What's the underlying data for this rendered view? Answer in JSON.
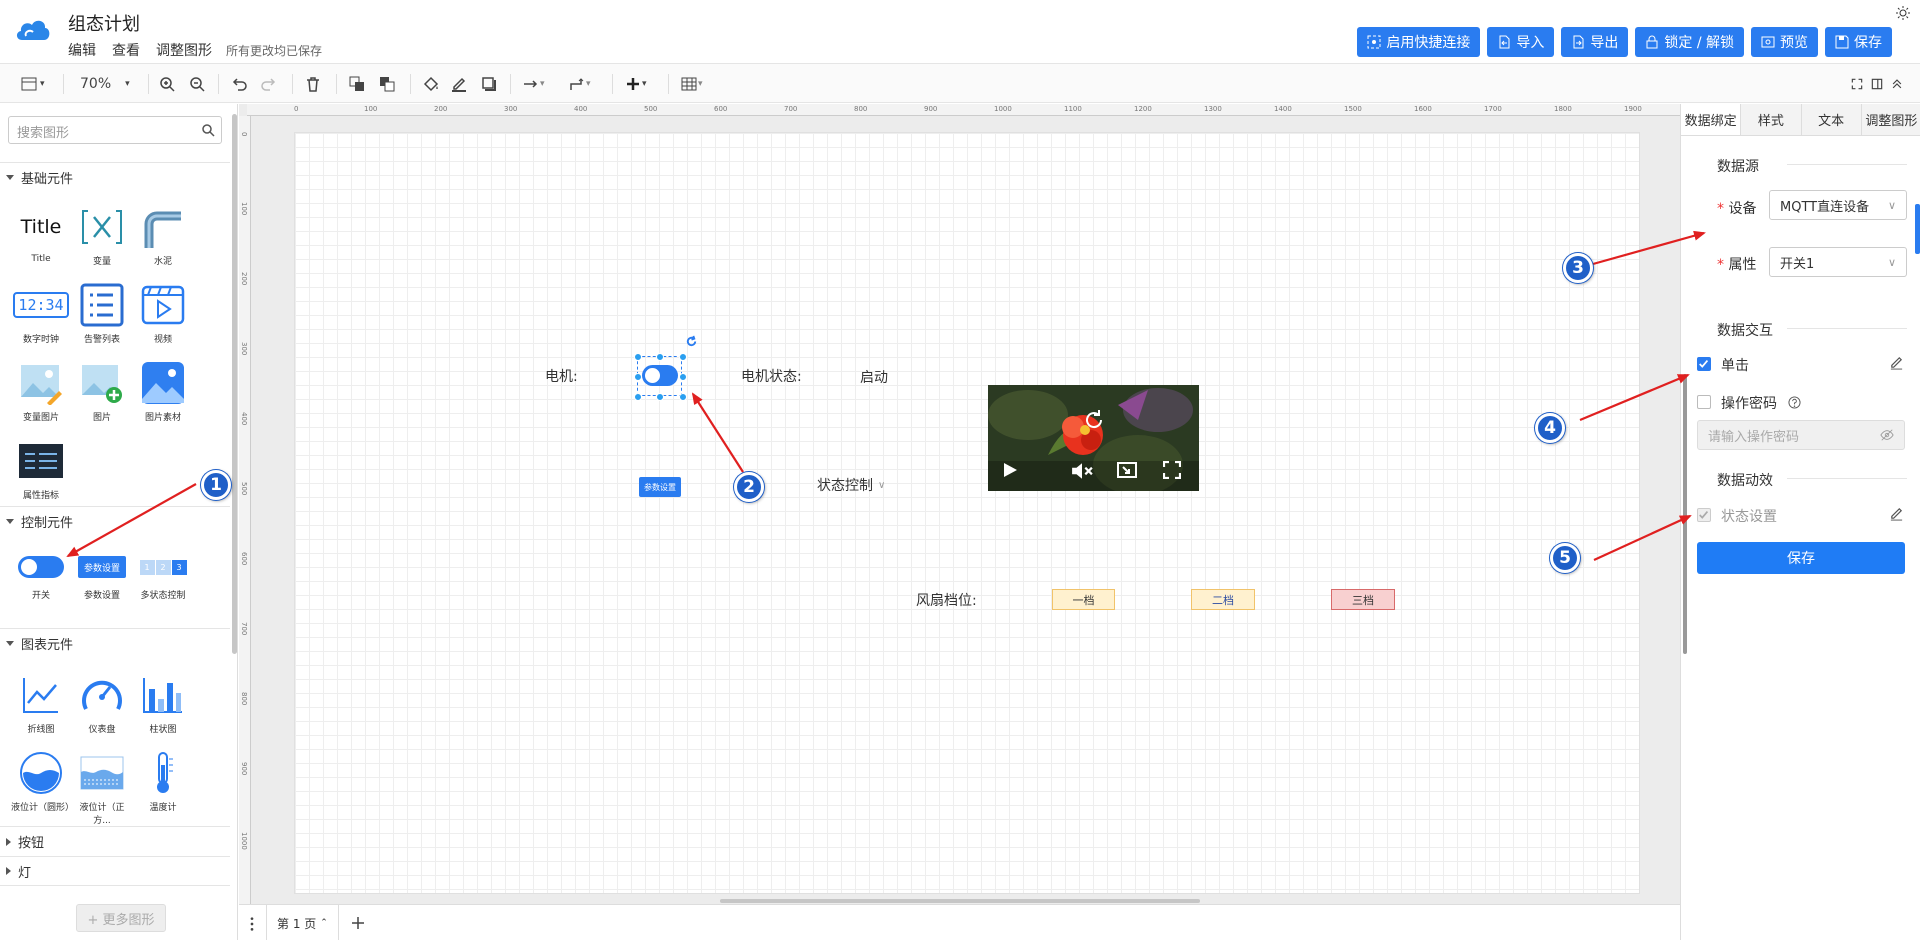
{
  "header": {
    "title": "组态计划",
    "menu": [
      "编辑",
      "查看",
      "调整图形"
    ],
    "saved_status": "所有更改均已保存",
    "buttons": [
      "启用快捷连接",
      "导入",
      "导出",
      "锁定 / 解锁",
      "预览",
      "保存"
    ],
    "accent": "#2a7cf0"
  },
  "toolbar": {
    "zoom": "70%"
  },
  "left_panel": {
    "search_placeholder": "搜索图形",
    "sections": {
      "basic": "基础元件",
      "control": "控制元件",
      "chart": "图表元件",
      "button": "按钮",
      "light": "灯"
    },
    "basic_items": [
      "Title",
      "变量",
      "水泥",
      "数字时钟",
      "告警列表",
      "视频",
      "变量图片",
      "图片",
      "图片素材",
      "属性指标"
    ],
    "control_items": [
      "开关",
      "参数设置",
      "多状态控制"
    ],
    "chart_items": [
      "折线图",
      "仪表盘",
      "柱状图",
      "液位计（圆形）",
      "液位计（正方...",
      "温度计"
    ],
    "title_icon_text": "Title",
    "clock_icon_text": "12:34",
    "param_icon_text": "参数设置",
    "multi_icon_text": [
      "1",
      "2",
      "3"
    ],
    "more_shapes": "+ 更多图形"
  },
  "ruler": {
    "top": [
      "0",
      "100",
      "200",
      "300",
      "400",
      "500",
      "600",
      "700",
      "800",
      "900",
      "1000",
      "1100",
      "1200",
      "1300",
      "1400",
      "1500",
      "1600",
      "1700",
      "1800",
      "1900"
    ],
    "left": [
      "0",
      "100",
      "200",
      "300",
      "400",
      "500",
      "600",
      "700",
      "800",
      "900",
      "1000"
    ]
  },
  "canvas": {
    "motor_label": "电机:",
    "motor_status_label": "电机状态:",
    "motor_status_value": "启动",
    "param_button": "参数设置",
    "state_control": "状态控制",
    "fan_label": "风扇档位:",
    "fan_levels": [
      "一档",
      "二档",
      "三档"
    ]
  },
  "bottom": {
    "page_tab": "第 1 页"
  },
  "right_panel": {
    "tabs": [
      "数据绑定",
      "样式",
      "文本",
      "调整图形"
    ],
    "data_source": "数据源",
    "device_label": "设备",
    "device_value": "MQTT直连设备",
    "property_label": "属性",
    "property_value": "开关1",
    "interaction": "数据交互",
    "click_label": "单击",
    "click_checked": true,
    "password_label": "操作密码",
    "password_placeholder": "请输入操作密码",
    "animation": "数据动效",
    "state_setting": "状态设置",
    "save": "保存"
  },
  "annotations": [
    "1",
    "2",
    "3",
    "4",
    "5"
  ]
}
